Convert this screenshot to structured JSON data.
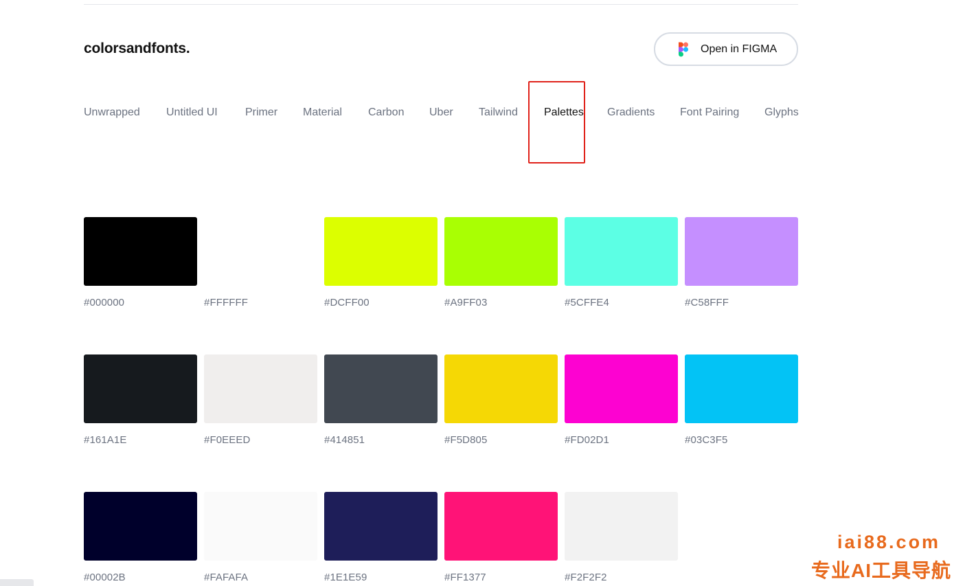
{
  "header": {
    "brand": "colorsandfonts.",
    "figma_button_label": "Open in FIGMA",
    "figma_icon": "figma-logo-icon",
    "figma_colors": [
      "#F24E1E",
      "#FF7262",
      "#A259FF",
      "#1ABCFE",
      "#0ACF83"
    ]
  },
  "nav": {
    "tabs": [
      {
        "label": "Unwrapped"
      },
      {
        "label": "Untitled UI"
      },
      {
        "label": "Primer"
      },
      {
        "label": "Material"
      },
      {
        "label": "Carbon"
      },
      {
        "label": "Uber"
      },
      {
        "label": "Tailwind"
      },
      {
        "label": "Palettes",
        "active": true
      },
      {
        "label": "Gradients"
      },
      {
        "label": "Font Pairing"
      },
      {
        "label": "Glyphs"
      }
    ],
    "highlight_color": "#E0221A"
  },
  "palettes": {
    "rows": [
      {
        "colors": [
          {
            "hex": "#000000"
          },
          {
            "hex": "#FFFFFF"
          },
          {
            "hex": "#DCFF00"
          },
          {
            "hex": "#A9FF03"
          },
          {
            "hex": "#5CFFE4"
          },
          {
            "hex": "#C58FFF"
          }
        ]
      },
      {
        "colors": [
          {
            "hex": "#161A1E"
          },
          {
            "hex": "#F0EEED"
          },
          {
            "hex": "#414851"
          },
          {
            "hex": "#F5D805"
          },
          {
            "hex": "#FD02D1"
          },
          {
            "hex": "#03C3F5"
          }
        ]
      },
      {
        "colors": [
          {
            "hex": "#00002B"
          },
          {
            "hex": "#FAFAFA"
          },
          {
            "hex": "#1E1E59"
          },
          {
            "hex": "#FF1377"
          },
          {
            "hex": "#F2F2F2"
          }
        ]
      }
    ]
  },
  "watermark": {
    "line1": "iai88.com",
    "line2": "专业AI工具导航",
    "color": "#E86A1D"
  }
}
